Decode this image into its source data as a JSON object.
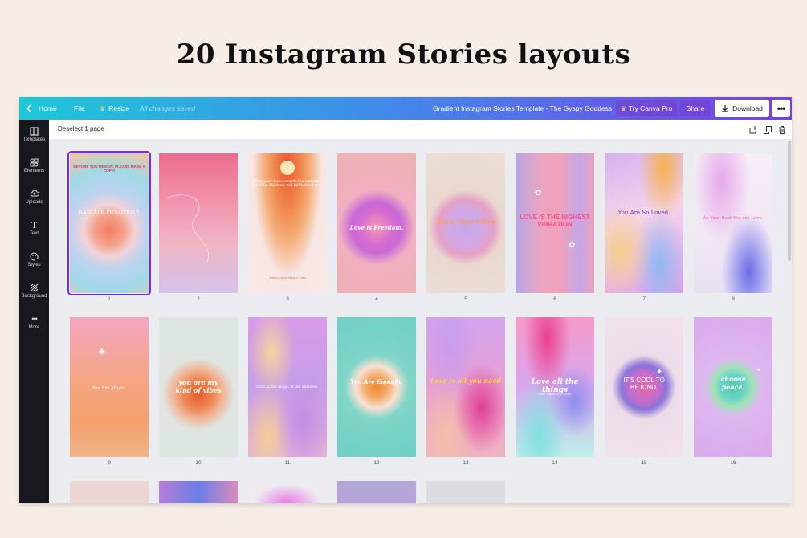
{
  "headline": "20 Instagram Stories layouts",
  "topbar": {
    "back_icon": "chevron-left-icon",
    "home": "Home",
    "file": "File",
    "resize_icon": "crown-icon",
    "resize": "Resize",
    "saved_status": "All changes saved",
    "doc_title": "Gradient Instagram Stories Template - The Gyspy Goddess",
    "try_pro": "Try Canva Pro",
    "share": "Share",
    "download": "Download",
    "more": "•••"
  },
  "sidebar": {
    "items": [
      {
        "label": "Templates",
        "icon": "templates-icon"
      },
      {
        "label": "Elements",
        "icon": "elements-icon"
      },
      {
        "label": "Uploads",
        "icon": "upload-cloud-icon"
      },
      {
        "label": "Text",
        "icon": "text-icon"
      },
      {
        "label": "Styles",
        "icon": "palette-icon"
      },
      {
        "label": "Background",
        "icon": "background-icon"
      },
      {
        "label": "More",
        "icon": "more-icon"
      }
    ]
  },
  "pagebar": {
    "deselect": "Deselect 1 page",
    "icons": [
      "add-page-icon",
      "duplicate-page-icon",
      "delete-page-icon"
    ]
  },
  "pages": [
    {
      "num": "1",
      "text": "BEFORE YOU DESIGN, PLEASE MAKE A COPY!",
      "text2": "RADIATE POSITIVITY",
      "selected": true
    },
    {
      "num": "2",
      "text": ""
    },
    {
      "num": "3",
      "text": "Keep your face towards the sunshine and the shadows will fall behind you",
      "text2": "www.yourwebsite.com"
    },
    {
      "num": "4",
      "text": "Love is Freedom."
    },
    {
      "num": "5",
      "text": "Trust Your Vibes"
    },
    {
      "num": "6",
      "text": "LOVE IS THE HIGHEST VIBRATION"
    },
    {
      "num": "7",
      "text": "You Are So Loved."
    },
    {
      "num": "8",
      "text": "As Your Best You are Love."
    },
    {
      "num": "9",
      "text": "You Are Magic."
    },
    {
      "num": "10",
      "text": "you are my kind of vibes"
    },
    {
      "num": "11",
      "text": "trust in the magic of the universe."
    },
    {
      "num": "12",
      "text": "You Are Enough."
    },
    {
      "num": "13",
      "text": "Love is all you need"
    },
    {
      "num": "14",
      "text": "Love all the things",
      "text2": "THAT MAKE YOU, YOU."
    },
    {
      "num": "15",
      "text": "IT'S COOL TO BE KIND."
    },
    {
      "num": "16",
      "text": "choose peace."
    }
  ]
}
